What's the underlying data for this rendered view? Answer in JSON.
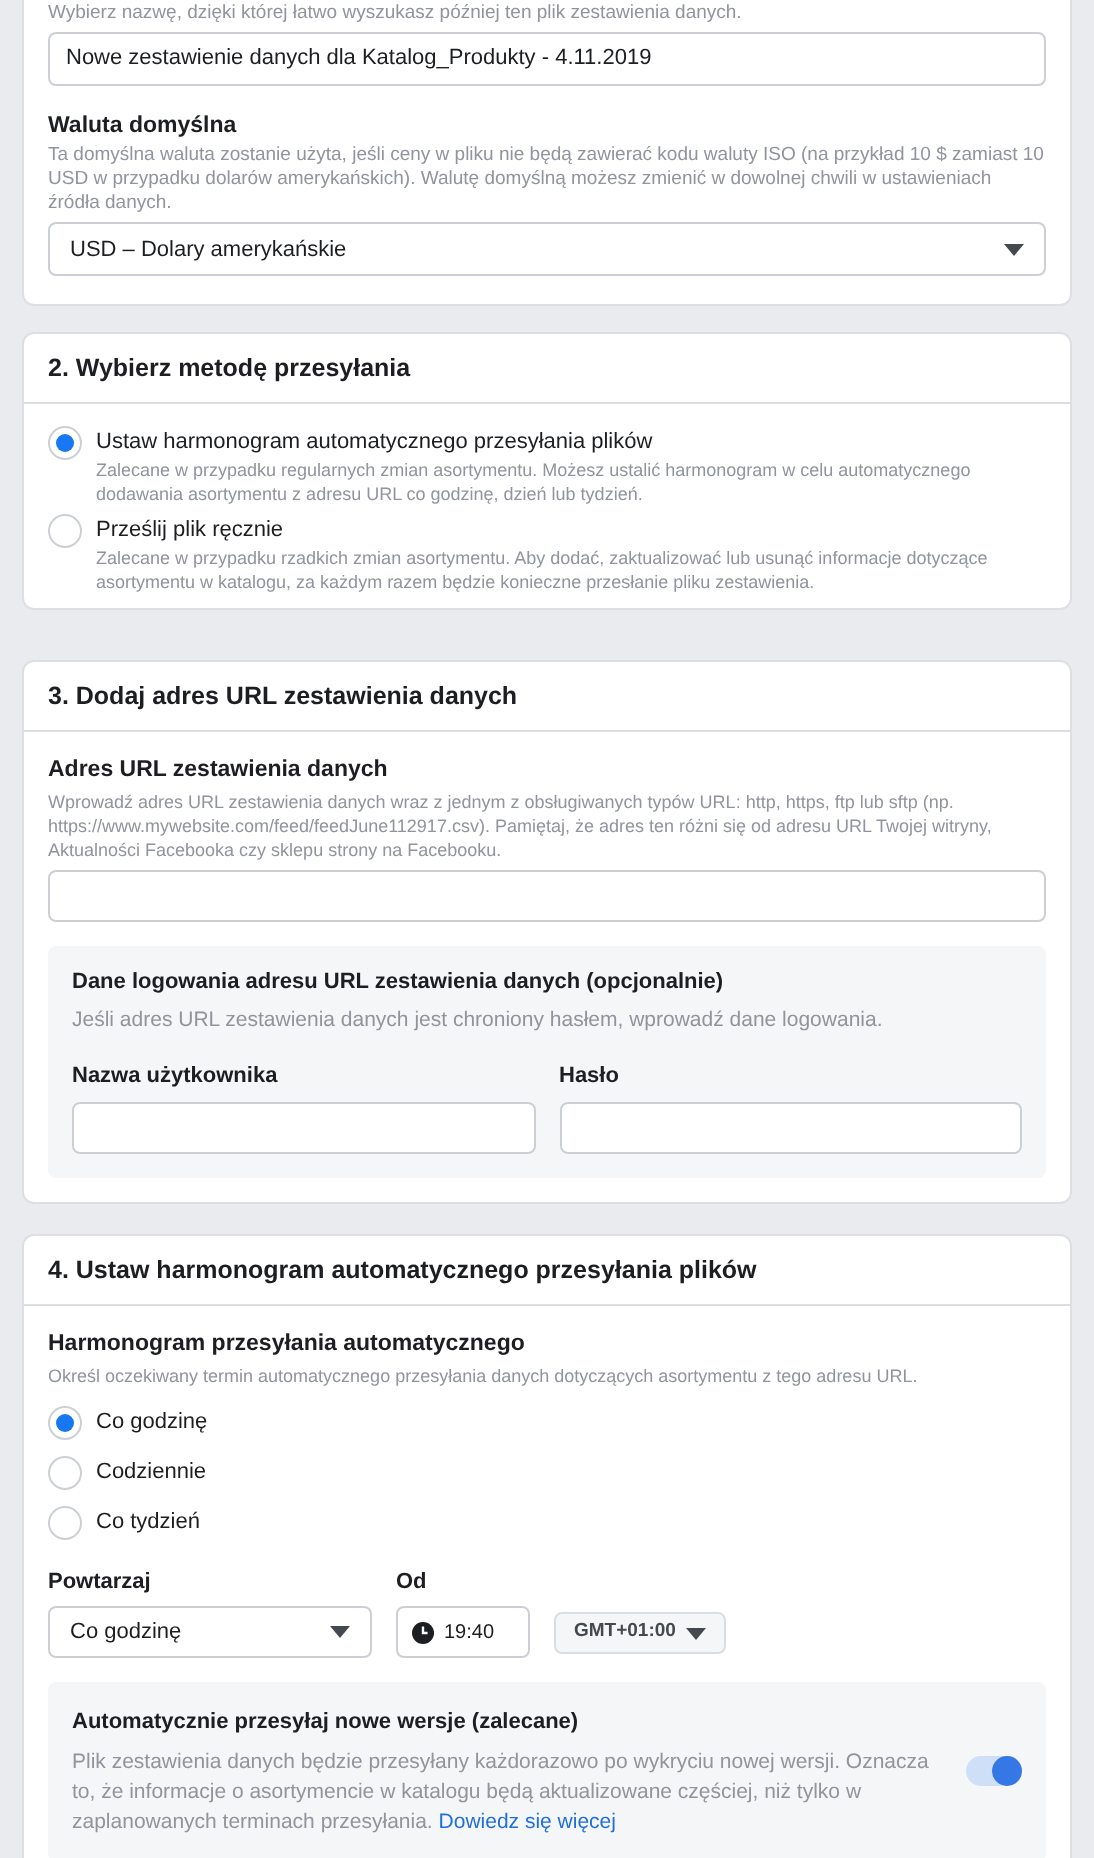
{
  "section1": {
    "hint": "Wybierz nazwę, dzięki której łatwo wyszukasz później ten plik zestawienia danych.",
    "name_field": {
      "value": "Nowe zestawienie danych dla Katalog_Produkty - 4.11.2019"
    },
    "currency": {
      "label": "Waluta domyślna",
      "hint": "Ta domyślna waluta zostanie użyta, jeśli ceny w pliku nie będą zawierać kodu waluty ISO (na przykład 10 $ zamiast 10 USD w przypadku dolarów amerykańskich). Walutę domyślną możesz zmienić w dowolnej chwili w ustawieniach źródła danych.",
      "value": "USD – Dolary amerykańskie"
    }
  },
  "section2": {
    "title": "2. Wybierz metodę przesyłania",
    "options": [
      {
        "label": "Ustaw harmonogram automatycznego przesyłania plików",
        "description": "Zalecane w przypadku regularnych zmian asortymentu. Możesz ustalić harmonogram w celu automatycznego dodawania asortymentu z adresu URL co godzinę, dzień lub tydzień.",
        "selected": true
      },
      {
        "label": "Prześlij plik ręcznie",
        "description": "Zalecane w przypadku rzadkich zmian asortymentu. Aby dodać, zaktualizować lub usunąć informacje dotyczące asortymentu w katalogu, za każdym razem będzie konieczne przesłanie pliku zestawienia.",
        "selected": false
      }
    ]
  },
  "section3": {
    "title": "3. Dodaj adres URL zestawienia danych",
    "url": {
      "label": "Adres URL zestawienia danych",
      "hint": "Wprowadź adres URL zestawienia danych wraz z jednym z obsługiwanych typów URL: http, https, ftp lub sftp (np. https://www.mywebsite.com/feed/feedJune112917.csv). Pamiętaj, że adres ten różni się od adresu URL Twojej witryny, Aktualności Facebooka czy sklepu strony na Facebooku."
    },
    "credentials": {
      "title": "Dane logowania adresu URL zestawienia danych (opcjonalnie)",
      "hint": "Jeśli adres URL zestawienia danych jest chroniony hasłem, wprowadź dane logowania.",
      "fields": [
        {
          "label": "Nazwa użytkownika"
        },
        {
          "label": "Hasło"
        }
      ]
    }
  },
  "section4": {
    "title": "4. Ustaw harmonogram automatycznego przesyłania plików",
    "schedule": {
      "label": "Harmonogram przesyłania automatycznego",
      "hint": "Określ oczekiwany termin automatycznego przesyłania danych dotyczących asortymentu z tego adresu URL.",
      "options": [
        {
          "label": "Co godzinę",
          "selected": true
        },
        {
          "label": "Codziennie",
          "selected": false
        },
        {
          "label": "Co tydzień",
          "selected": false
        }
      ]
    },
    "repeat": {
      "label": "Powtarzaj",
      "value": "Co godzinę"
    },
    "from": {
      "label": "Od",
      "time": "19:40"
    },
    "timezone": "GMT+01:00",
    "auto": {
      "title": "Automatycznie przesyłaj nowe wersje (zalecane)",
      "text": "Plik zestawienia danych będzie przesyłany każdorazowo po wykryciu nowej wersji. Oznacza to, że informacje o asortymencie w katalogu będą aktualizowane częściej, niż tylko w zaplanowanych terminach przesyłania.",
      "link": "Dowiedz się więcej",
      "on": true
    }
  }
}
